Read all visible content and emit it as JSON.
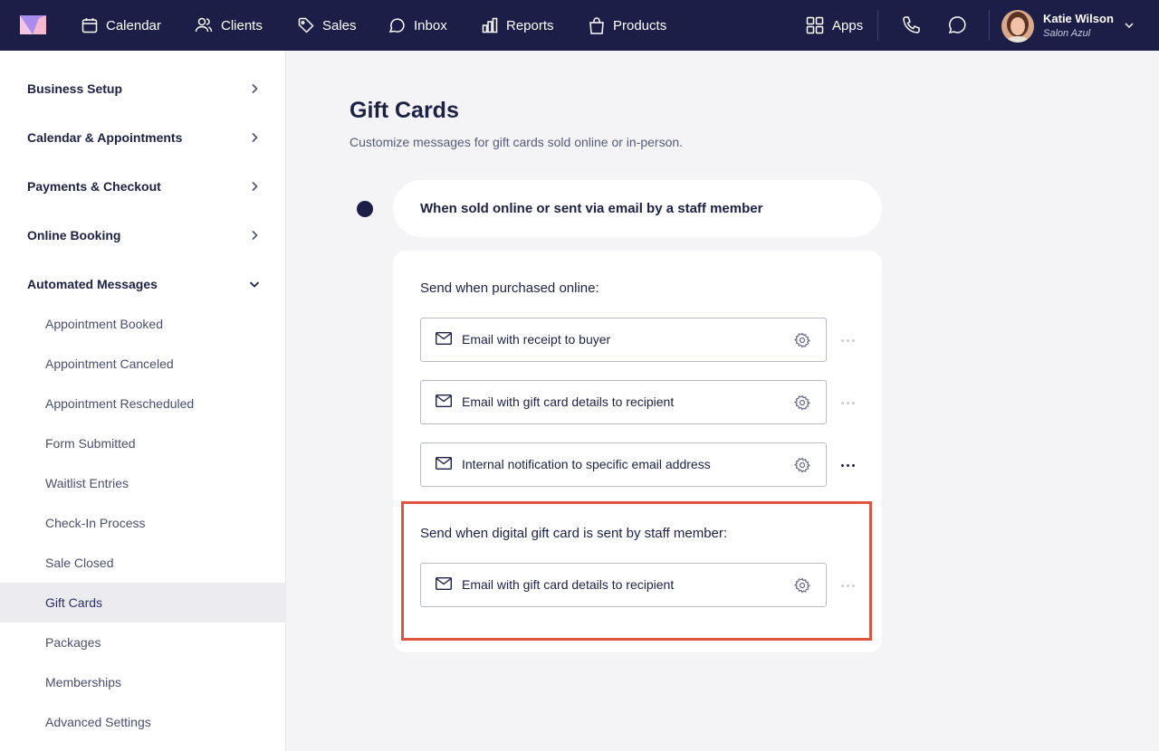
{
  "nav": {
    "items": [
      {
        "label": "Calendar",
        "icon": "calendar-icon"
      },
      {
        "label": "Clients",
        "icon": "users-icon"
      },
      {
        "label": "Sales",
        "icon": "tag-icon"
      },
      {
        "label": "Inbox",
        "icon": "inbox-icon"
      },
      {
        "label": "Reports",
        "icon": "bar-chart-icon"
      },
      {
        "label": "Products",
        "icon": "shopping-bag-icon"
      }
    ],
    "apps_label": "Apps",
    "user": {
      "name": "Katie Wilson",
      "salon": "Salon Azul"
    }
  },
  "sidebar": {
    "sections": [
      {
        "label": "Business Setup",
        "expanded": false
      },
      {
        "label": "Calendar & Appointments",
        "expanded": false
      },
      {
        "label": "Payments & Checkout",
        "expanded": false
      },
      {
        "label": "Online Booking",
        "expanded": false
      },
      {
        "label": "Automated Messages",
        "expanded": true
      }
    ],
    "subitems": [
      "Appointment Booked",
      "Appointment Canceled",
      "Appointment Rescheduled",
      "Form Submitted",
      "Waitlist Entries",
      "Check-In Process",
      "Sale Closed",
      "Gift Cards",
      "Packages",
      "Memberships",
      "Advanced Settings"
    ],
    "active_subitem": "Gift Cards"
  },
  "main": {
    "title": "Gift Cards",
    "subtitle": "Customize messages for gift cards sold online or in-person.",
    "trigger": "When sold online or sent via email by a staff member",
    "groups": [
      {
        "label": "Send when purchased online:",
        "messages": [
          {
            "label": "Email with receipt to buyer"
          },
          {
            "label": "Email with gift card details to recipient"
          },
          {
            "label": "Internal notification to specific email address"
          }
        ]
      },
      {
        "label": "Send when digital gift card is sent by staff member:",
        "messages": [
          {
            "label": "Email with gift card details to recipient"
          }
        ]
      }
    ]
  },
  "colors": {
    "nav_bg": "#1b1f47",
    "page_bg": "#f4f4f6",
    "highlight": "#e0533f",
    "active_bg": "#ebebf0"
  }
}
